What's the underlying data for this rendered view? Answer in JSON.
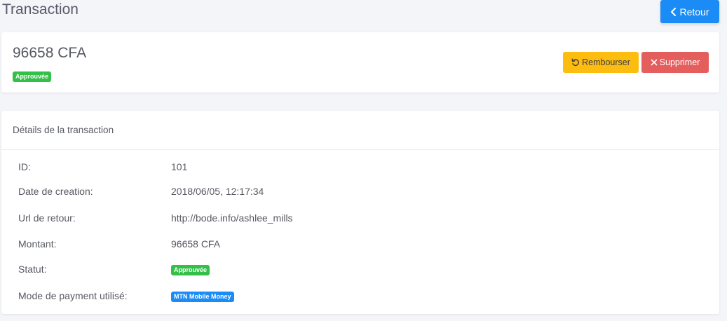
{
  "header": {
    "title": "Transaction",
    "back_label": "Retour"
  },
  "summary": {
    "amount": "96658 CFA",
    "status_badge": "Approuvée",
    "refund_label": "Rembourser",
    "delete_label": "Supprimer"
  },
  "details": {
    "title": "Détails de la transaction",
    "rows": [
      {
        "label": "ID:",
        "value": "101"
      },
      {
        "label": "Date de creation:",
        "value": "2018/06/05, 12:17:34"
      },
      {
        "label": "Url de retour:",
        "value": "http://bode.info/ashlee_mills"
      },
      {
        "label": "Montant:",
        "value": "96658 CFA"
      },
      {
        "label": "Statut:",
        "value": "Approuvée"
      },
      {
        "label": "Mode de payment utilisé:",
        "value": "MTN Mobile Money"
      }
    ]
  },
  "colors": {
    "primary": "#1b8cf5",
    "success": "#34bf49",
    "warning": "#fcbc10",
    "danger": "#e45e5e"
  },
  "icons": {
    "back": "chevron-left-icon",
    "refund": "undo-icon",
    "delete": "close-icon"
  }
}
